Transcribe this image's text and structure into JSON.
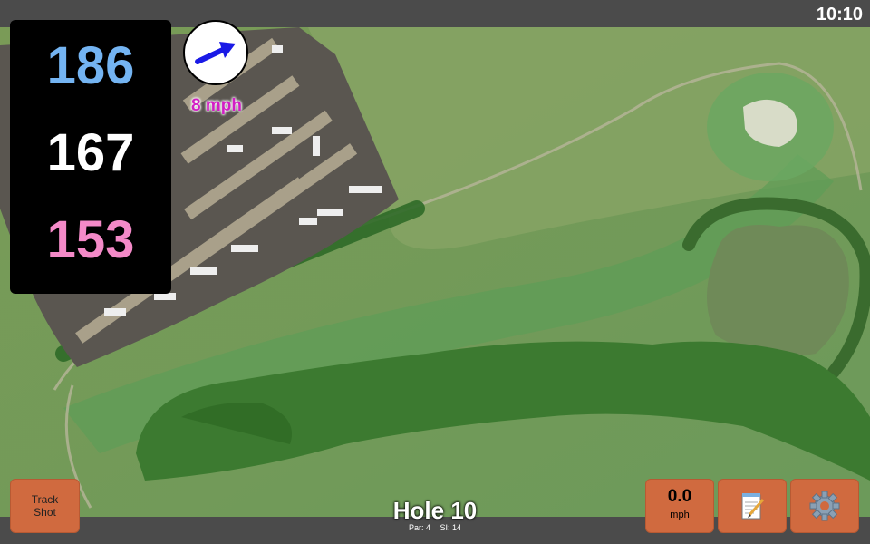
{
  "status_bar": {
    "time": "10:10"
  },
  "distances": {
    "back": "186",
    "middle": "167",
    "front": "153"
  },
  "colors": {
    "back": "#74b4f2",
    "middle": "#ffffff",
    "front": "#f48ac8",
    "button": "#d06a3f",
    "wind_arrow": "#1a1ae6",
    "wind_text": "#d21fc4"
  },
  "wind": {
    "speed_label": "8 mph",
    "icon": "arrow-icon"
  },
  "buttons": {
    "track_line1": "Track",
    "track_line2": "Shot",
    "speed_value": "0.0",
    "speed_unit": "mph",
    "notes_icon": "notepad-icon",
    "settings_icon": "gear-icon"
  },
  "hole": {
    "title": "Hole 10",
    "par": "Par: 4",
    "si": "SI: 14"
  }
}
